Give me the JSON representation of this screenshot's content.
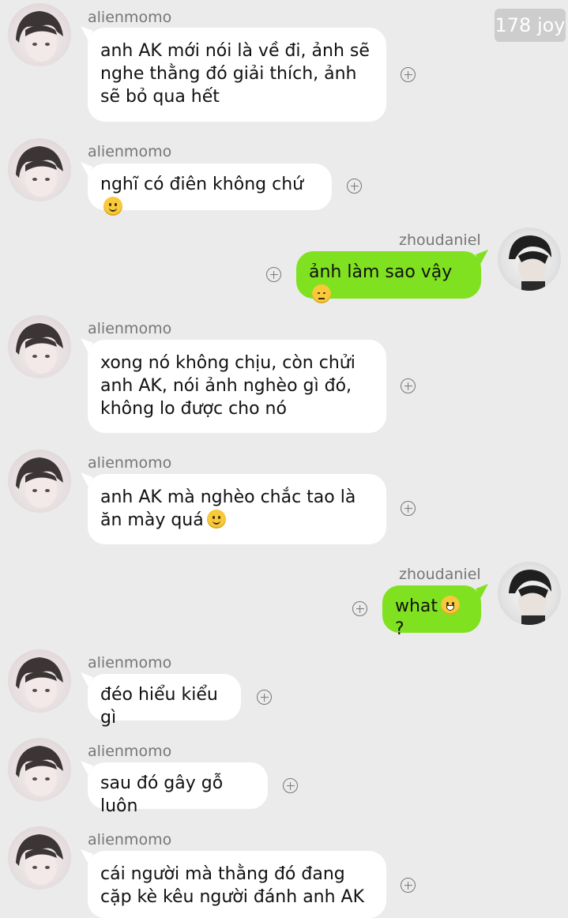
{
  "watermark": "178 joy",
  "messages": [
    {
      "sender": "alienmomo",
      "text": "anh AK mới nói là về đi, ảnh sẽ nghe thằng đó giải thích, ảnh sẽ bỏ qua hết",
      "emoji": ""
    },
    {
      "sender": "alienmomo",
      "text": "nghĩ có điên không chứ",
      "emoji": "slightly-smiling-face"
    },
    {
      "sender": "zhoudaniel",
      "text": "ảnh làm sao vậy",
      "emoji": "face-with-steam"
    },
    {
      "sender": "alienmomo",
      "text": "xong nó không chịu, còn chửi anh AK, nói ảnh nghèo gì đó, không lo được cho nó",
      "emoji": ""
    },
    {
      "sender": "alienmomo",
      "text": "anh AK mà nghèo chắc tao là ăn mày quá",
      "emoji": "slightly-smiling-face"
    },
    {
      "sender": "zhoudaniel",
      "text": "what",
      "text_after": "?",
      "emoji": "grinning-face"
    },
    {
      "sender": "alienmomo",
      "text": "đéo hiểu kiểu gì",
      "emoji": ""
    },
    {
      "sender": "alienmomo",
      "text": "sau đó gây gỗ luôn",
      "emoji": ""
    },
    {
      "sender": "alienmomo",
      "text": "cái người mà thằng đó đang cặp kè kêu người đánh anh AK",
      "emoji": ""
    }
  ],
  "icons": {
    "add": "plus-circle-icon",
    "avatar_left": "avatar-alienmomo",
    "avatar_right": "avatar-zhoudaniel"
  },
  "colors": {
    "background": "#ebebeb",
    "incoming_bubble": "#ffffff",
    "outgoing_bubble": "#7fe11f",
    "name_text": "#767676"
  }
}
